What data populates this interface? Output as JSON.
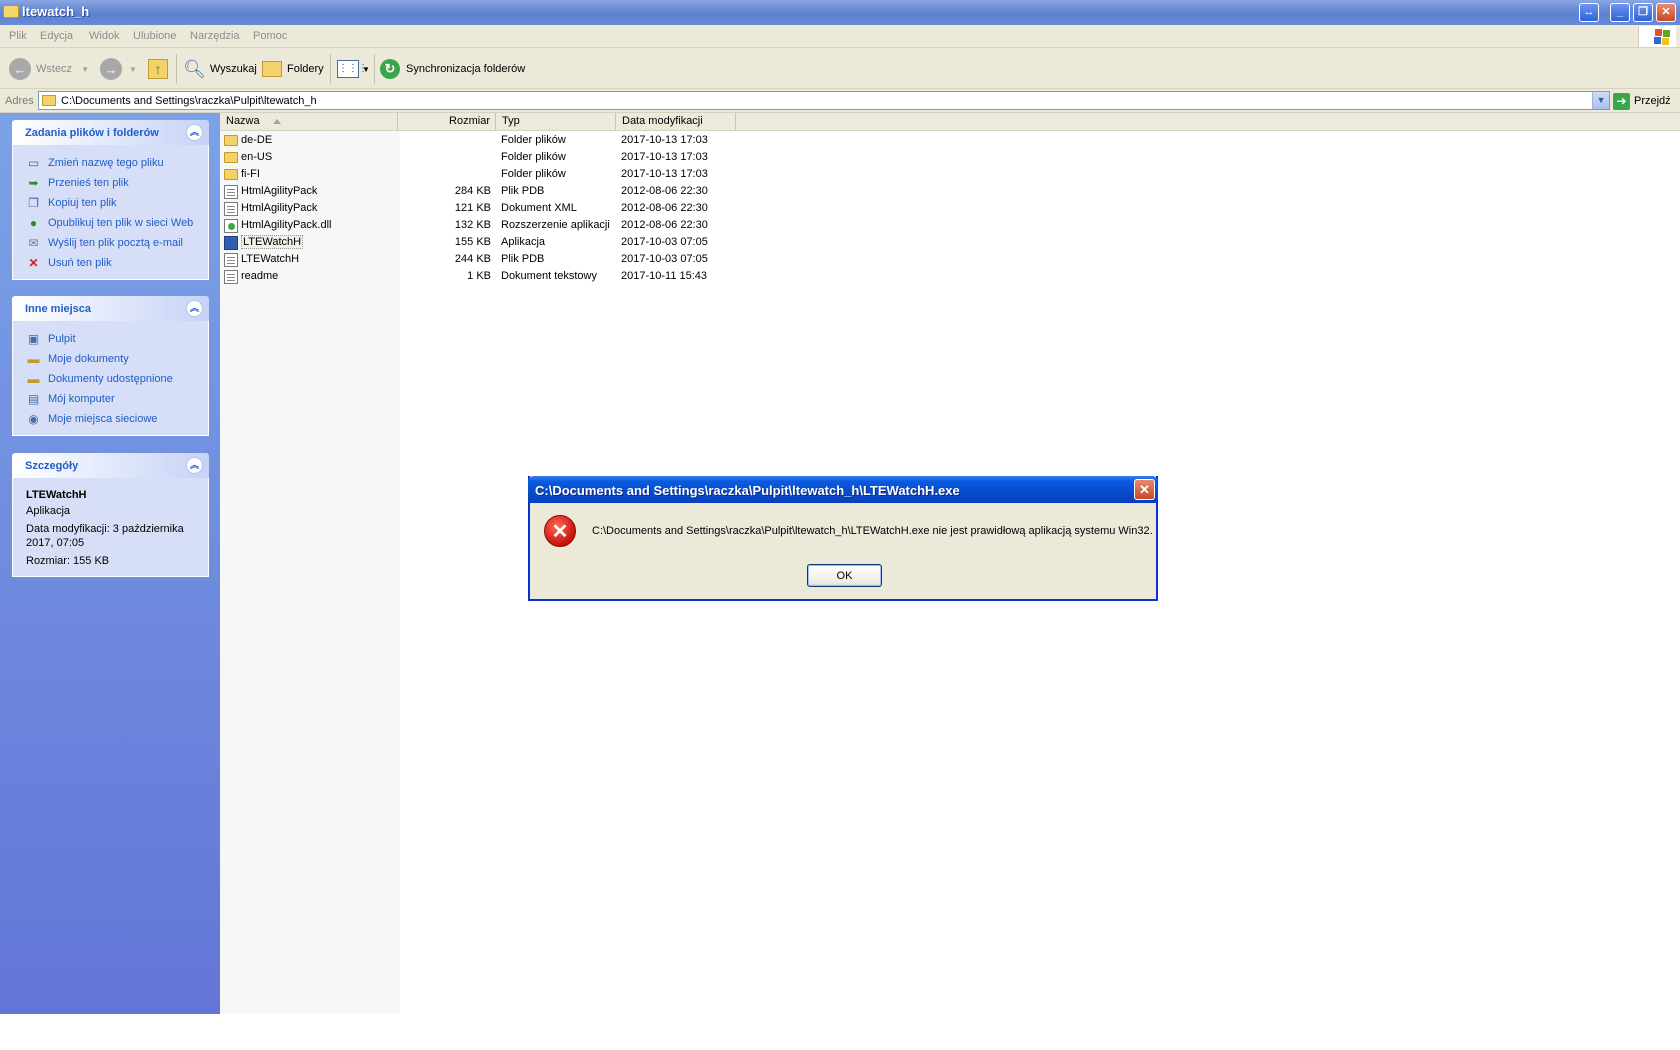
{
  "window": {
    "title": "ltewatch_h"
  },
  "menu": [
    "Plik",
    "Edycja",
    "Widok",
    "Ulubione",
    "Narzędzia",
    "Pomoc"
  ],
  "toolbar": {
    "back": "Wstecz",
    "search": "Wyszukaj",
    "folders": "Foldery",
    "sync": "Synchronizacja folderów"
  },
  "address": {
    "label": "Adres",
    "path": "C:\\Documents and Settings\\raczka\\Pulpit\\ltewatch_h",
    "go": "Przejdź"
  },
  "tasks": {
    "file_tasks": {
      "title": "Zadania plików i folderów",
      "items": [
        "Zmień nazwę tego pliku",
        "Przenieś ten plik",
        "Kopiuj ten plik",
        "Opublikuj ten plik w sieci Web",
        "Wyślij ten plik pocztą e-mail",
        "Usuń ten plik"
      ]
    },
    "other_places": {
      "title": "Inne miejsca",
      "items": [
        "Pulpit",
        "Moje dokumenty",
        "Dokumenty udostępnione",
        "Mój komputer",
        "Moje miejsca sieciowe"
      ]
    },
    "details": {
      "title": "Szczegóły",
      "name": "LTEWatchH",
      "type": "Aplikacja",
      "modified": "Data modyfikacji: 3 października 2017, 07:05",
      "size": "Rozmiar: 155 KB"
    }
  },
  "columns": {
    "name": "Nazwa",
    "size": "Rozmiar",
    "type": "Typ",
    "date": "Data modyfikacji"
  },
  "files": [
    {
      "name": "de-DE",
      "size": "",
      "type": "Folder plików",
      "date": "2017-10-13 17:03",
      "icon": "folder"
    },
    {
      "name": "en-US",
      "size": "",
      "type": "Folder plików",
      "date": "2017-10-13 17:03",
      "icon": "folder"
    },
    {
      "name": "fi-FI",
      "size": "",
      "type": "Folder plików",
      "date": "2017-10-13 17:03",
      "icon": "folder"
    },
    {
      "name": "HtmlAgilityPack",
      "size": "284 KB",
      "type": "Plik PDB",
      "date": "2012-08-06 22:30",
      "icon": "doc"
    },
    {
      "name": "HtmlAgilityPack",
      "size": "121 KB",
      "type": "Dokument XML",
      "date": "2012-08-06 22:30",
      "icon": "doc"
    },
    {
      "name": "HtmlAgilityPack.dll",
      "size": "132 KB",
      "type": "Rozszerzenie aplikacji",
      "date": "2012-08-06 22:30",
      "icon": "dll"
    },
    {
      "name": "LTEWatchH",
      "size": "155 KB",
      "type": "Aplikacja",
      "date": "2017-10-03 07:05",
      "icon": "exe"
    },
    {
      "name": "LTEWatchH",
      "size": "244 KB",
      "type": "Plik PDB",
      "date": "2017-10-03 07:05",
      "icon": "doc"
    },
    {
      "name": "readme",
      "size": "1 KB",
      "type": "Dokument tekstowy",
      "date": "2017-10-11 15:43",
      "icon": "doc"
    }
  ],
  "dialog": {
    "title": "C:\\Documents and Settings\\raczka\\Pulpit\\ltewatch_h\\LTEWatchH.exe",
    "message": "C:\\Documents and Settings\\raczka\\Pulpit\\ltewatch_h\\LTEWatchH.exe nie jest prawidłową aplikacją systemu Win32.",
    "ok": "OK"
  }
}
